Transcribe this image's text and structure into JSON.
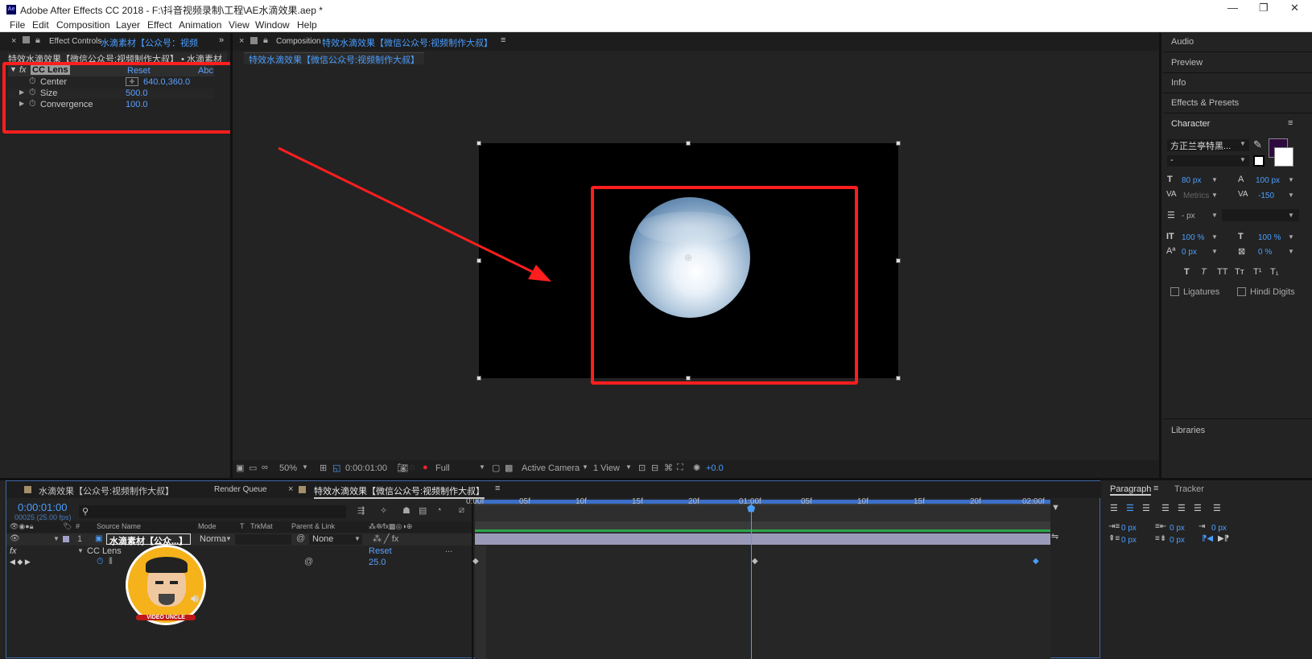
{
  "window": {
    "app_icon": "Ae",
    "title": "Adobe After Effects CC 2018 - F:\\抖音视频录制\\工程\\AE水滴效果.aep *",
    "min_glyph": "—",
    "max_glyph": "❐",
    "close_glyph": "✕"
  },
  "menu": [
    "File",
    "Edit",
    "Composition",
    "Layer",
    "Effect",
    "Animation",
    "View",
    "Window",
    "Help"
  ],
  "effect_controls": {
    "tab_label": "Effect Controls",
    "tab_layer": "水滴素材【公众号：视频",
    "subtitle": "特效水滴效果【微信公众号:视频制作大叔】 • 水滴素材",
    "effect_name": "CC Lens",
    "reset": "Reset",
    "about": "Abc",
    "props": [
      {
        "name": "Center",
        "value": "640.0,360.0"
      },
      {
        "name": "Size",
        "value": "500.0"
      },
      {
        "name": "Convergence",
        "value": "100.0"
      }
    ]
  },
  "composition": {
    "tab_label": "Composition",
    "tab_name": "特效水滴效果【微信公众号:视频制作大叔】",
    "sub_tab": "特效水滴效果【微信公众号:视频制作大叔】",
    "zoom": "50%",
    "timecode": "0:00:01:00",
    "resolution": "Full",
    "camera": "Active Camera",
    "views": "1 View",
    "exposure": "+0.0"
  },
  "right_panel": {
    "items": [
      "Audio",
      "Preview",
      "Info",
      "Effects & Presets",
      "Character"
    ],
    "font_name": "方正兰亭特黑...",
    "font_style": "-",
    "font_size": "80 px",
    "leading": "100 px",
    "kerning": "Metrics",
    "tracking": "-150",
    "stroke_width": "- px",
    "vert_scale": "100 %",
    "horiz_scale": "100 %",
    "baseline": "0 px",
    "tsume": "0 %",
    "style_buttons": [
      "T",
      "T",
      "TT",
      "Tт",
      "T¹",
      "T₁"
    ],
    "ligatures": "Ligatures",
    "hindi_digits": "Hindi Digits",
    "libraries": "Libraries",
    "fill_color": "#2e0a3f"
  },
  "timeline": {
    "tabs": [
      "水滴效果【公众号:视频制作大叔】",
      "Render Queue",
      "特效水滴效果【微信公众号:视频制作大叔】"
    ],
    "timecode": "0:00:01:00",
    "frame_info": "00025 (25.00 fps)",
    "search_placeholder": "",
    "col_headers": {
      "source_name": "Source Name",
      "mode": "Mode",
      "t": "T",
      "trkmat": "TrkMat",
      "parent": "Parent & Link"
    },
    "layer": {
      "index": "1",
      "name": "水滴素材【公众...】",
      "mode": "Norma",
      "parent": "None"
    },
    "effect_row": "CC Lens",
    "effect_reset": "Reset",
    "prop_value": "25.0",
    "ruler_ticks": [
      "0:00f",
      "05f",
      "10f",
      "15f",
      "20f",
      "01:00f",
      "05f",
      "10f",
      "15f",
      "20f",
      "02:00f"
    ]
  },
  "paragraph": {
    "tabs": [
      "Paragraph",
      "Tracker"
    ],
    "indent_left": "0 px",
    "indent_right": "0 px",
    "first_line": "0 px",
    "space_before": "0 px",
    "space_after": "0 px"
  },
  "avatar": {
    "badge": "VIDEO UNCLE"
  }
}
